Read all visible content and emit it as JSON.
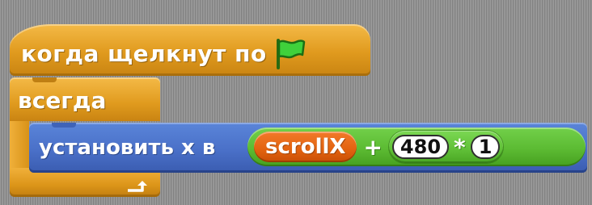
{
  "script": {
    "hat_block": {
      "label": "когда щелкнут по",
      "icon": "green-flag-icon",
      "color": "#e09a1e"
    },
    "forever_block": {
      "label": "всегда",
      "icon": "loop-arrow-icon",
      "color": "#e09a1e"
    },
    "motion_block": {
      "label": "установить х в",
      "color": "#4a70c8",
      "operator": {
        "color": "#5cbb33",
        "reporter": {
          "label": "scrollX",
          "color": "#e2620f"
        },
        "plus_symbol": "+",
        "inner_operator": {
          "left_value": "480",
          "times_symbol": "*",
          "right_value": "1"
        }
      }
    }
  }
}
